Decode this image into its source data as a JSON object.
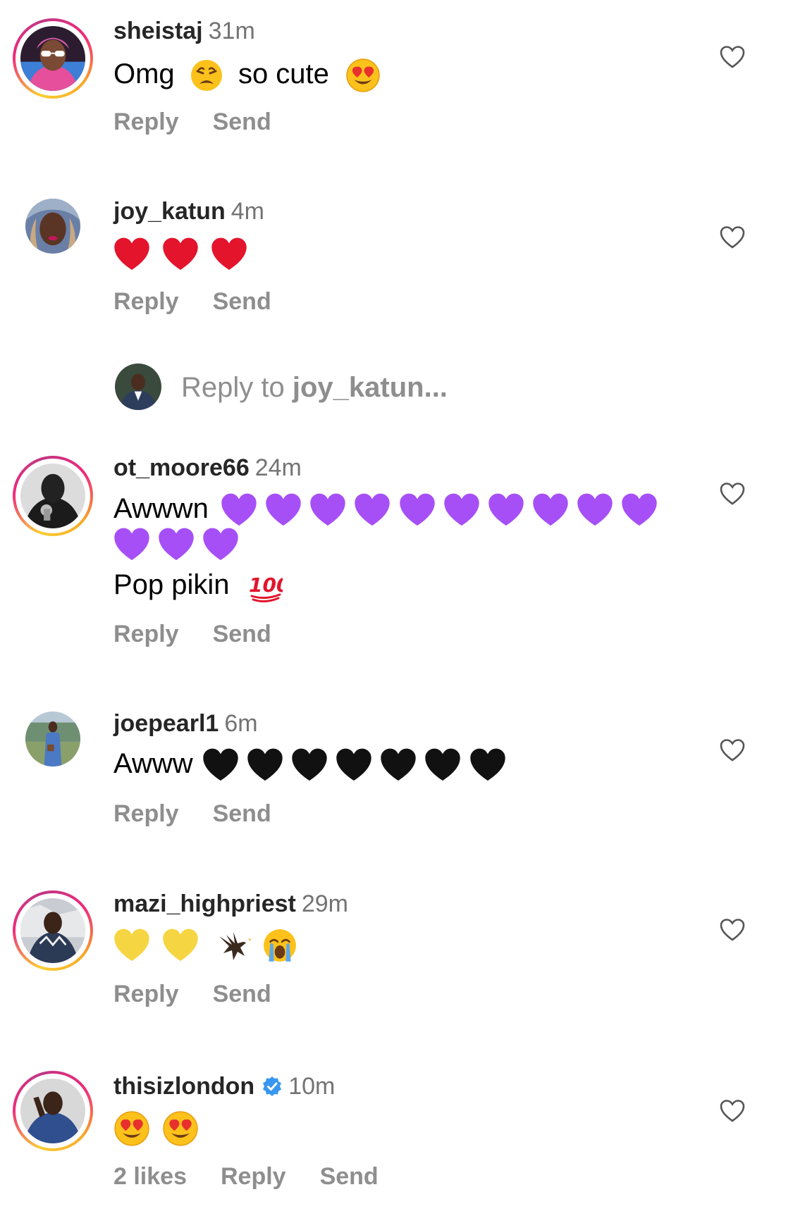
{
  "colors": {
    "username": "#262626",
    "secondary_text": "#8e8e8e",
    "verified_blue": "#3897f0",
    "purple_heart": "#a64ff6",
    "yellow_heart": "#f6d543",
    "black_heart": "#111111",
    "red_heart": "#e3142c"
  },
  "comments": [
    {
      "username": "sheistaj",
      "time": "31m",
      "text_prefix": "Omg",
      "text_middle": "so cute",
      "actions": {
        "reply": "Reply",
        "send": "Send"
      }
    },
    {
      "username": "joy_katun",
      "time": "4m",
      "emojis": [
        "red-heart-emoji",
        "red-heart-emoji",
        "red-heart-emoji"
      ],
      "actions": {
        "reply": "Reply",
        "send": "Send"
      }
    },
    {
      "username": "ot_moore66",
      "time": "24m",
      "text_prefix": "Awwwn",
      "line2": "Pop pikin",
      "actions": {
        "reply": "Reply",
        "send": "Send"
      }
    },
    {
      "username": "joepearl1",
      "time": "6m",
      "text_prefix": "Awww",
      "actions": {
        "reply": "Reply",
        "send": "Send"
      }
    },
    {
      "username": "mazi_highpriest",
      "time": "29m",
      "actions": {
        "reply": "Reply",
        "send": "Send"
      }
    },
    {
      "username": "thisizlondon",
      "time": "10m",
      "verified": true,
      "actions": {
        "likes": "2 likes",
        "reply": "Reply",
        "send": "Send"
      }
    }
  ],
  "reply_prompt": {
    "prefix": "Reply to ",
    "target": "joy_katun..."
  }
}
